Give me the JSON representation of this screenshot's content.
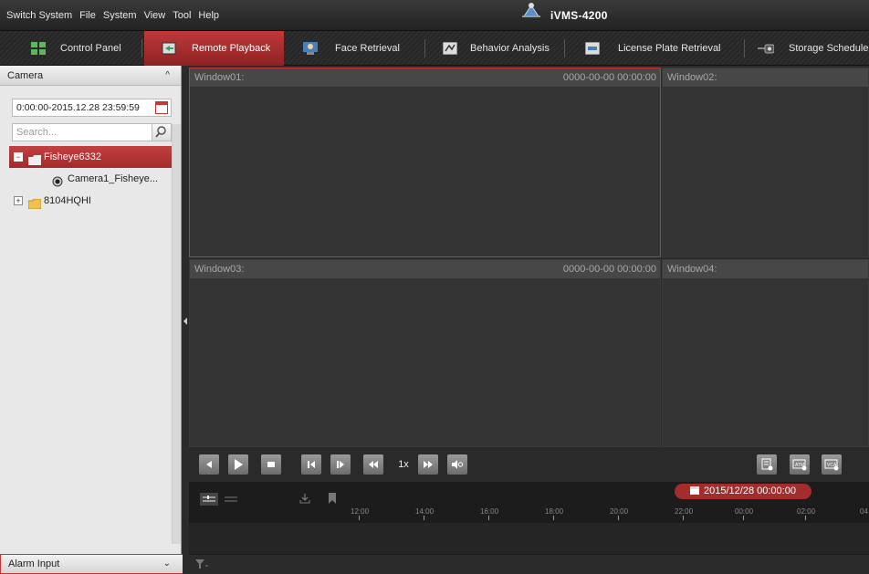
{
  "menu": {
    "items": [
      "Switch System",
      "File",
      "System",
      "View",
      "Tool",
      "Help"
    ]
  },
  "app": {
    "title": "iVMS-4200"
  },
  "tabs": [
    {
      "label": "Control Panel",
      "icon": "control-panel-icon",
      "active": false
    },
    {
      "label": "Remote Playback",
      "icon": "remote-playback-icon",
      "active": true
    },
    {
      "label": "Face Retrieval",
      "icon": "face-retrieval-icon",
      "active": false
    },
    {
      "label": "Behavior Analysis",
      "icon": "behavior-analysis-icon",
      "active": false
    },
    {
      "label": "License Plate Retrieval",
      "icon": "license-plate-icon",
      "active": false
    },
    {
      "label": "Storage Schedule",
      "icon": "storage-schedule-icon",
      "active": false
    }
  ],
  "left_panel": {
    "camera_header": "Camera",
    "time_range": "0:00:00-2015.12.28 23:59:59",
    "search_placeholder": "Search...",
    "tree": [
      {
        "label": "Fisheye6332",
        "expander": "−",
        "selected": true
      },
      {
        "label": "Camera1_Fisheye...",
        "child": true
      },
      {
        "label": "8104HQHI",
        "expander": "+"
      }
    ],
    "alarm_header": "Alarm Input"
  },
  "windows": [
    {
      "label": "Window01:",
      "timestamp": "0000-00-00 00:00:00",
      "selected": true
    },
    {
      "label": "Window02:",
      "timestamp": ""
    },
    {
      "label": "Window03:",
      "timestamp": "0000-00-00 00:00:00"
    },
    {
      "label": "Window04:",
      "timestamp": ""
    }
  ],
  "controls": {
    "speed": "1x"
  },
  "timeline": {
    "date": "2015/12/28 00:00:00",
    "ticks": [
      "12:00",
      "14:00",
      "16:00",
      "18:00",
      "20:00",
      "22:00",
      "00:00",
      "02:00",
      "04"
    ]
  },
  "colors": {
    "accent": "#a32c2d",
    "panel_bg": "#e8e8e8",
    "window_bg": "#333333"
  }
}
